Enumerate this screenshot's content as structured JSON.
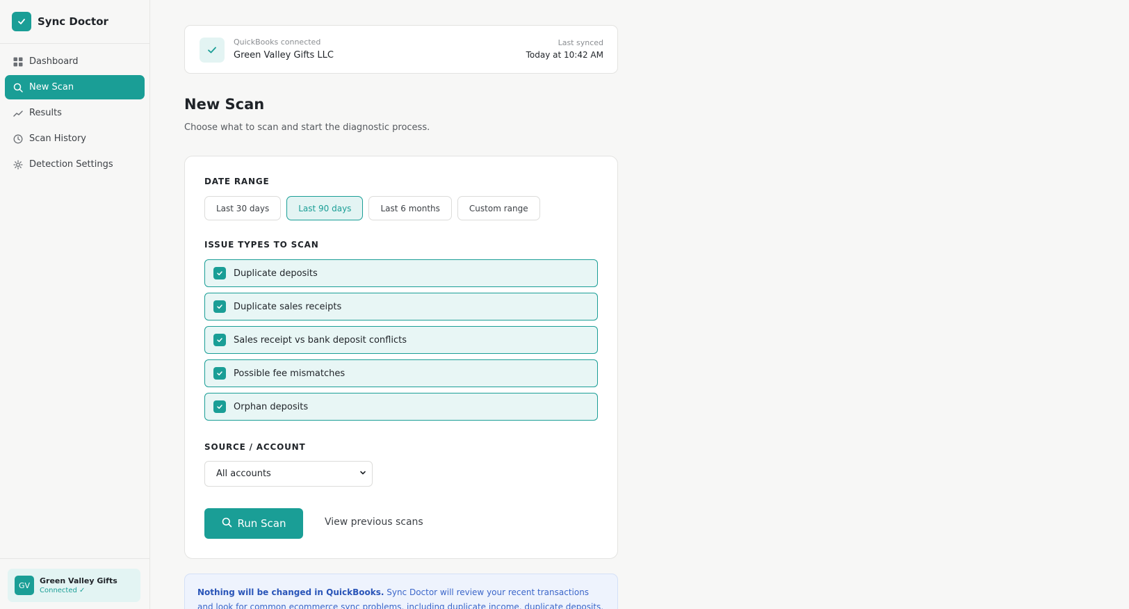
{
  "app": {
    "name": "Sync Doctor",
    "brand_color": "#1a9e96"
  },
  "sidebar": {
    "items": [
      {
        "label": "Dashboard",
        "icon": "grid-icon",
        "active": false
      },
      {
        "label": "New Scan",
        "icon": "search-icon",
        "active": true
      },
      {
        "label": "Results",
        "icon": "trend-icon",
        "active": false
      },
      {
        "label": "Scan History",
        "icon": "clock-icon",
        "active": false
      },
      {
        "label": "Detection Settings",
        "icon": "gear-icon",
        "active": false
      }
    ],
    "account": {
      "initials": "GV",
      "name": "Green Valley Gifts",
      "status": "Connected ✓"
    }
  },
  "connection": {
    "label": "QuickBooks connected",
    "company": "Green Valley Gifts LLC",
    "last_synced_label": "Last synced",
    "last_synced_value": "Today at 10:42 AM"
  },
  "page": {
    "title": "New Scan",
    "subtitle": "Choose what to scan and start the diagnostic process."
  },
  "form": {
    "date_range_label": "DATE RANGE",
    "date_ranges": [
      {
        "label": "Last 30 days",
        "selected": false
      },
      {
        "label": "Last 90 days",
        "selected": true
      },
      {
        "label": "Last 6 months",
        "selected": false
      },
      {
        "label": "Custom range",
        "selected": false
      }
    ],
    "issue_types_label": "ISSUE TYPES TO SCAN",
    "issue_types": [
      {
        "label": "Duplicate deposits",
        "checked": true
      },
      {
        "label": "Duplicate sales receipts",
        "checked": true
      },
      {
        "label": "Sales receipt vs bank deposit conflicts",
        "checked": true
      },
      {
        "label": "Possible fee mismatches",
        "checked": true
      },
      {
        "label": "Orphan deposits",
        "checked": true
      }
    ],
    "source_label": "SOURCE / ACCOUNT",
    "source_value": "All accounts",
    "run_button": "Run Scan",
    "secondary_link": "View previous scans"
  },
  "info": {
    "bold": "Nothing will be changed in QuickBooks.",
    "text": " Sync Doctor will review your recent transactions and look for common ecommerce sync problems, including duplicate income, duplicate deposits, and"
  }
}
